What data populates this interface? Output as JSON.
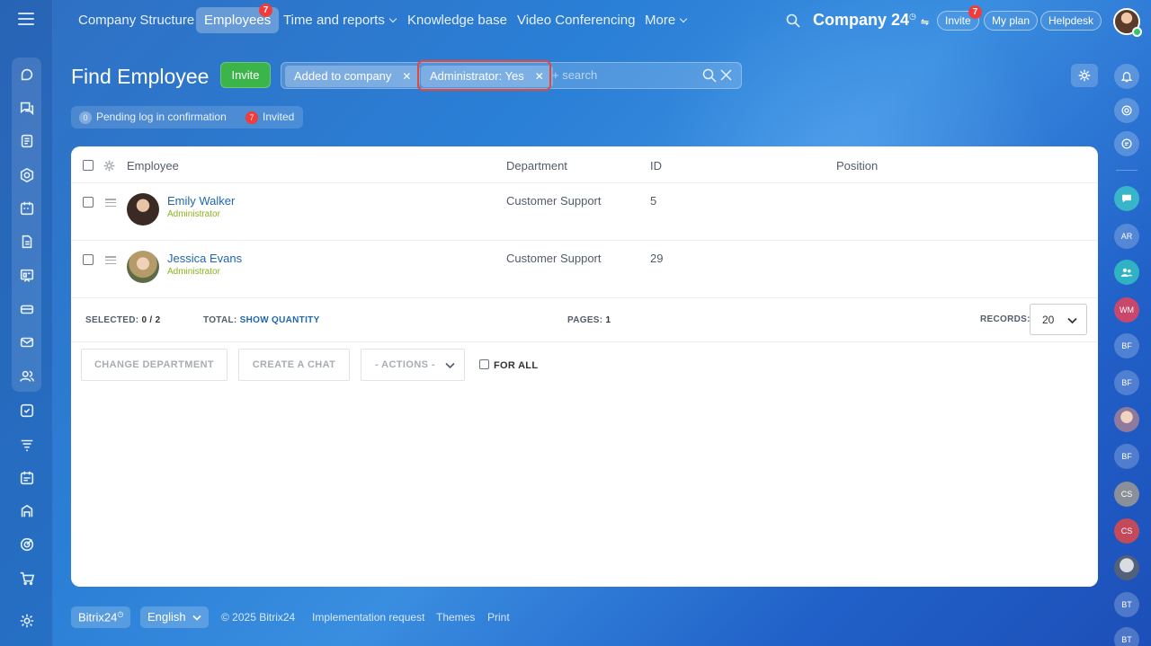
{
  "topnav": {
    "items": [
      {
        "label": "Company Structure"
      },
      {
        "label": "Employees",
        "badge": "7"
      },
      {
        "label": "Time and reports"
      },
      {
        "label": "Knowledge base"
      },
      {
        "label": "Video Conferencing"
      },
      {
        "label": "More"
      }
    ],
    "company": "Company 24",
    "invite_label": "Invite",
    "invite_badge": "7",
    "myplan_label": "My plan",
    "helpdesk_label": "Helpdesk"
  },
  "header": {
    "title": "Find Employee",
    "invite_button": "Invite",
    "filters": [
      {
        "label": "Added to company"
      },
      {
        "label": "Administrator: Yes"
      }
    ],
    "search_placeholder": "+ search",
    "counters": [
      {
        "count": "0",
        "label": "Pending log in confirmation"
      },
      {
        "count": "7",
        "label": "Invited"
      }
    ]
  },
  "table": {
    "columns": [
      "Employee",
      "Department",
      "ID",
      "Position"
    ],
    "rows": [
      {
        "name": "Emily Walker",
        "role": "Administrator",
        "department": "Customer Support",
        "id": "5",
        "position": ""
      },
      {
        "name": "Jessica Evans",
        "role": "Administrator",
        "department": "Customer Support",
        "id": "29",
        "position": ""
      }
    ],
    "footer": {
      "selected_label": "SELECTED:",
      "selected_value": "0 / 2",
      "total_label": "TOTAL:",
      "total_link": "SHOW QUANTITY",
      "pages_label": "PAGES:",
      "pages_value": "1",
      "records_label": "RECORDS:",
      "records_value": "20"
    },
    "actions": {
      "change_department": "CHANGE DEPARTMENT",
      "create_chat": "CREATE A CHAT",
      "actions_select": "- ACTIONS -",
      "for_all": "FOR ALL"
    }
  },
  "page_footer": {
    "brand": "Bitrix24",
    "language": "English",
    "copyright": "© 2025 Bitrix24",
    "implementation": "Implementation request",
    "themes": "Themes",
    "print": "Print"
  },
  "right_bar": {
    "initials": [
      "AR",
      "WM",
      "BF",
      "BF",
      "BF",
      "CS",
      "CS",
      "BT",
      "BT"
    ]
  },
  "colors": {
    "accent": "#2067b0",
    "invite_green": "#3bb54a",
    "badge_red": "#f23c3c",
    "role_green": "#8ab319",
    "highlight": "#e5473c"
  }
}
